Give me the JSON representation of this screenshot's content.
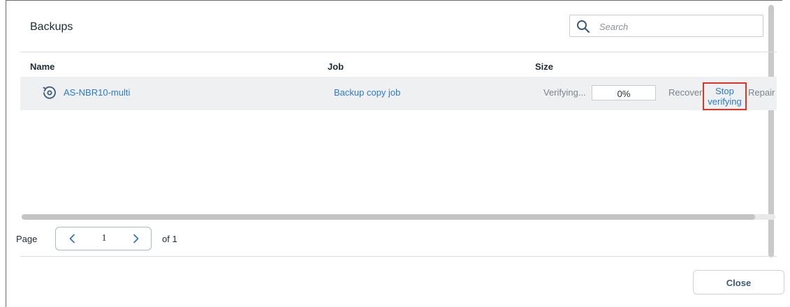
{
  "header": {
    "title": "Backups",
    "search_placeholder": "Search"
  },
  "table": {
    "columns": {
      "name": "Name",
      "job": "Job",
      "size": "Size"
    },
    "rows": [
      {
        "name": "AS-NBR10-multi",
        "job": "Backup copy job",
        "status": "Verifying...",
        "progress": "0%",
        "progress_value": 0,
        "actions": {
          "recover": "Recover",
          "stop_verifying": "Stop verifying",
          "repair": "Repair"
        }
      }
    ]
  },
  "pagination": {
    "page_label": "Page",
    "current_page": "1",
    "of_label": "of 1"
  },
  "footer": {
    "close_label": "Close"
  },
  "colors": {
    "link": "#2a7bd1",
    "highlight": "#e63222",
    "row_bg": "#eef0f2"
  },
  "icons": {
    "search": "search-icon",
    "backup": "backup-restore-icon",
    "prev": "chevron-left-icon",
    "next": "chevron-right-icon"
  }
}
